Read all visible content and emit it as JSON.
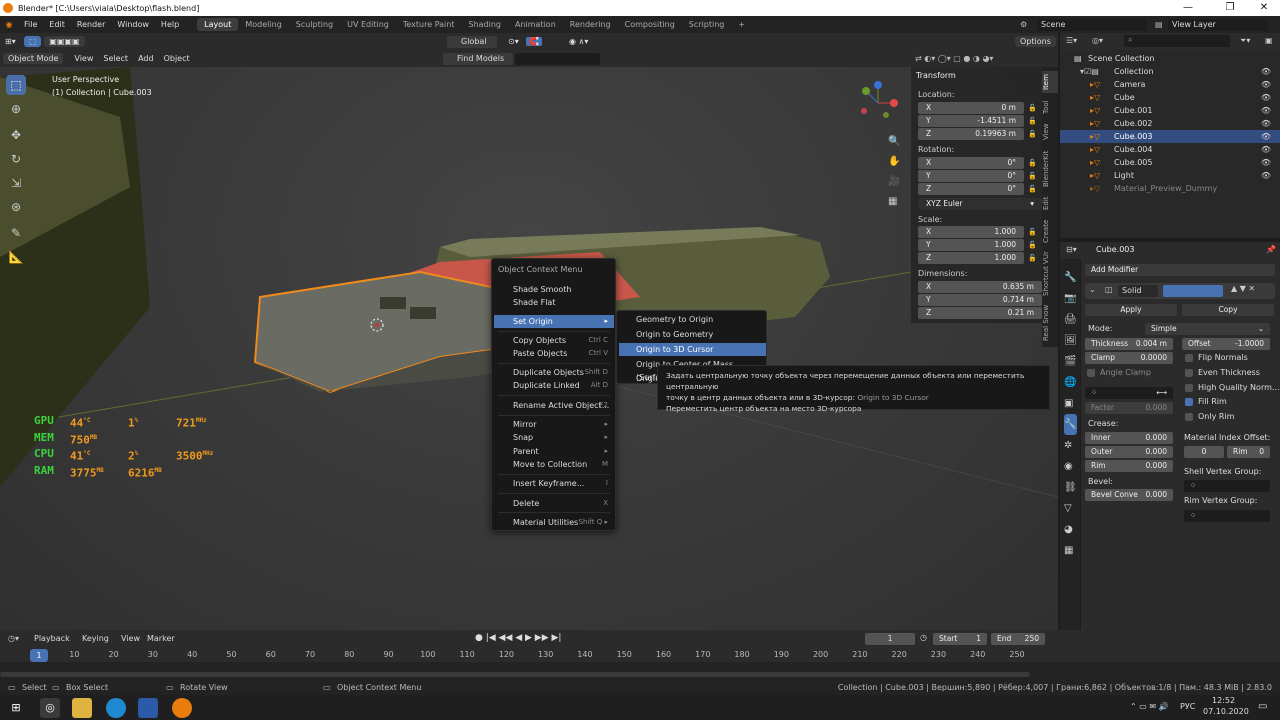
{
  "window": {
    "title": "Blender* [C:\\Users\\viala\\Desktop\\flash.blend]",
    "minimize": "—",
    "maximize": "❐",
    "close": "✕"
  },
  "menu": {
    "items": [
      "File",
      "Edit",
      "Render",
      "Window",
      "Help"
    ],
    "workspaces": [
      "Layout",
      "Modeling",
      "Sculpting",
      "UV Editing",
      "Texture Paint",
      "Shading",
      "Animation",
      "Rendering",
      "Compositing",
      "Scripting"
    ],
    "add_tab": "+",
    "scene": "Scene",
    "view_layer": "View Layer"
  },
  "tool_header": {
    "orientation": "Global",
    "options": "Options"
  },
  "viewport_header": {
    "mode": "Object Mode",
    "items": [
      "View",
      "Select",
      "Add",
      "Object"
    ],
    "find": "Find Models"
  },
  "viewport": {
    "perspective": "User Perspective",
    "collection": "(1) Collection | Cube.003"
  },
  "hud": {
    "rows": [
      {
        "label": "GPU",
        "v1": "44",
        "u1": "°C",
        "v2": "1",
        "u2": "%",
        "v3": "721",
        "u3": "MHz"
      },
      {
        "label": "MEM",
        "v1": "750",
        "u1": "MB",
        "v2": "",
        "u2": "",
        "v3": "",
        "u3": ""
      },
      {
        "label": "CPU",
        "v1": "41",
        "u1": "°C",
        "v2": "2",
        "u2": "%",
        "v3": "3500",
        "u3": "MHz"
      },
      {
        "label": "RAM",
        "v1": "3775",
        "u1": "MB",
        "v2": "6216",
        "u2": "MB",
        "v3": "",
        "u3": ""
      }
    ]
  },
  "context_menu": {
    "title": "Object Context Menu",
    "items": [
      {
        "label": "Shade Smooth",
        "shortcut": ""
      },
      {
        "label": "Shade Flat",
        "shortcut": ""
      },
      {
        "label": "Set Origin",
        "shortcut": "▸"
      },
      {
        "label": "Copy Objects",
        "shortcut": "Ctrl C"
      },
      {
        "label": "Paste Objects",
        "shortcut": "Ctrl V"
      },
      {
        "label": "Duplicate Objects",
        "shortcut": "Shift D"
      },
      {
        "label": "Duplicate Linked",
        "shortcut": "Alt D"
      },
      {
        "label": "Rename Active Object...",
        "shortcut": "F2"
      },
      {
        "label": "Mirror",
        "shortcut": "▸"
      },
      {
        "label": "Snap",
        "shortcut": "▸"
      },
      {
        "label": "Parent",
        "shortcut": "▸"
      },
      {
        "label": "Move to Collection",
        "shortcut": "M"
      },
      {
        "label": "Insert Keyframe...",
        "shortcut": "I"
      },
      {
        "label": "Delete",
        "shortcut": "X"
      },
      {
        "label": "Material Utilities",
        "shortcut": "Shift Q ▸"
      }
    ]
  },
  "submenu": {
    "items": [
      "Geometry to Origin",
      "Origin to Geometry",
      "Origin to 3D Cursor",
      "Origin to Center of Mass (Surface)",
      "Origin to Center of Mass (Volume)"
    ]
  },
  "tooltip": {
    "line1": "Задать центральную точку объекта через перемещение данных объекта или переместить центральную",
    "line2": "точку в центр данных объекта или в 3D-курсор:",
    "python": "Origin to 3D Cursor",
    "line3": "Переместить центр объекта на место 3D-курсора"
  },
  "transform": {
    "title": "Transform",
    "location_label": "Location:",
    "location": [
      {
        "axis": "X",
        "value": "0 m"
      },
      {
        "axis": "Y",
        "value": "-1.4511 m"
      },
      {
        "axis": "Z",
        "value": "0.19963 m"
      }
    ],
    "rotation_label": "Rotation:",
    "rotation": [
      {
        "axis": "X",
        "value": "0°"
      },
      {
        "axis": "Y",
        "value": "0°"
      },
      {
        "axis": "Z",
        "value": "0°"
      }
    ],
    "rotation_mode": "XYZ Euler",
    "scale_label": "Scale:",
    "scale": [
      {
        "axis": "X",
        "value": "1.000"
      },
      {
        "axis": "Y",
        "value": "1.000"
      },
      {
        "axis": "Z",
        "value": "1.000"
      }
    ],
    "dimensions_label": "Dimensions:",
    "dimensions": [
      {
        "axis": "X",
        "value": "0.635 m"
      },
      {
        "axis": "Y",
        "value": "0.714 m"
      },
      {
        "axis": "Z",
        "value": "0.21 m"
      }
    ]
  },
  "n_tabs": [
    "Item",
    "Tool",
    "View",
    "BlenderKit",
    "Edit",
    "Create",
    "Shortcut VUr",
    "Real Snow"
  ],
  "outliner": {
    "root": "Scene Collection",
    "rows": [
      {
        "name": "Collection",
        "indent": 1,
        "selected": false
      },
      {
        "name": "Camera",
        "indent": 2,
        "selected": false
      },
      {
        "name": "Cube",
        "indent": 2,
        "selected": false
      },
      {
        "name": "Cube.001",
        "indent": 2,
        "selected": false
      },
      {
        "name": "Cube.002",
        "indent": 2,
        "selected": false
      },
      {
        "name": "Cube.003",
        "indent": 2,
        "selected": true
      },
      {
        "name": "Cube.004",
        "indent": 2,
        "selected": false
      },
      {
        "name": "Cube.005",
        "indent": 2,
        "selected": false
      },
      {
        "name": "Light",
        "indent": 2,
        "selected": false
      },
      {
        "name": "Material_Preview_Dummy",
        "indent": 2,
        "selected": false
      }
    ]
  },
  "properties": {
    "object": "Cube.003",
    "add_modifier": "Add Modifier",
    "modifier_name": "Solid",
    "apply": "Apply",
    "copy": "Copy",
    "mode_label": "Mode:",
    "mode": "Simple",
    "thickness_label": "Thickness",
    "thickness": "0.004 m",
    "offset_label": "Offset",
    "offset": "-1.0000",
    "clamp_label": "Clamp",
    "clamp": "0.0000",
    "angle_clamp": "Angle Clamp",
    "factor_label": "Factor",
    "factor": "0.000",
    "flip_normals": "Flip Normals",
    "even_thickness": "Even Thickness",
    "high_quality": "High Quality Norm...",
    "fill_rim": "Fill Rim",
    "only_rim": "Only Rim",
    "crease_label": "Crease:",
    "inner_label": "Inner",
    "inner": "0.000",
    "outer_label": "Outer",
    "outer": "0.000",
    "rim_label": "Rim",
    "rim": "0.000",
    "mat_offset_label": "Material Index Offset:",
    "mat_offset": "0",
    "mat_rim_label": "Rim",
    "mat_rim": "0",
    "bevel_label": "Bevel:",
    "bevel_convex_label": "Bevel Conve",
    "bevel_convex": "0.000",
    "shell_vg": "Shell Vertex Group:",
    "rim_vg": "Rim Vertex Group:"
  },
  "timeline": {
    "menus": [
      "Playback",
      "Keying",
      "View",
      "Marker"
    ],
    "current_frame": "1",
    "start_label": "Start",
    "start": "1",
    "end_label": "End",
    "end": "250",
    "ticks": [
      "1",
      "10",
      "20",
      "30",
      "40",
      "50",
      "60",
      "70",
      "80",
      "90",
      "100",
      "110",
      "120",
      "130",
      "140",
      "150",
      "160",
      "170",
      "180",
      "190",
      "200",
      "210",
      "220",
      "230",
      "240",
      "250"
    ]
  },
  "status": {
    "select": "Select",
    "box_select": "Box Select",
    "rotate_view": "Rotate View",
    "context_menu": "Object Context Menu",
    "info": "Collection | Cube.003 | Вершин:5,890 | Рёбер:4,007 | Грани:6,862 | Объектов:1/8 | Пам.: 48.3 MiB | 2.83.0"
  },
  "taskbar": {
    "lang": "РУС",
    "time": "12:52",
    "date": "07.10.2020"
  },
  "colors": {
    "accent": "#4772b3",
    "selected_row": "#334d80",
    "orange": "#e87d0d",
    "hud_green": "#3bd33b",
    "hud_orange": "#f09a1c"
  }
}
